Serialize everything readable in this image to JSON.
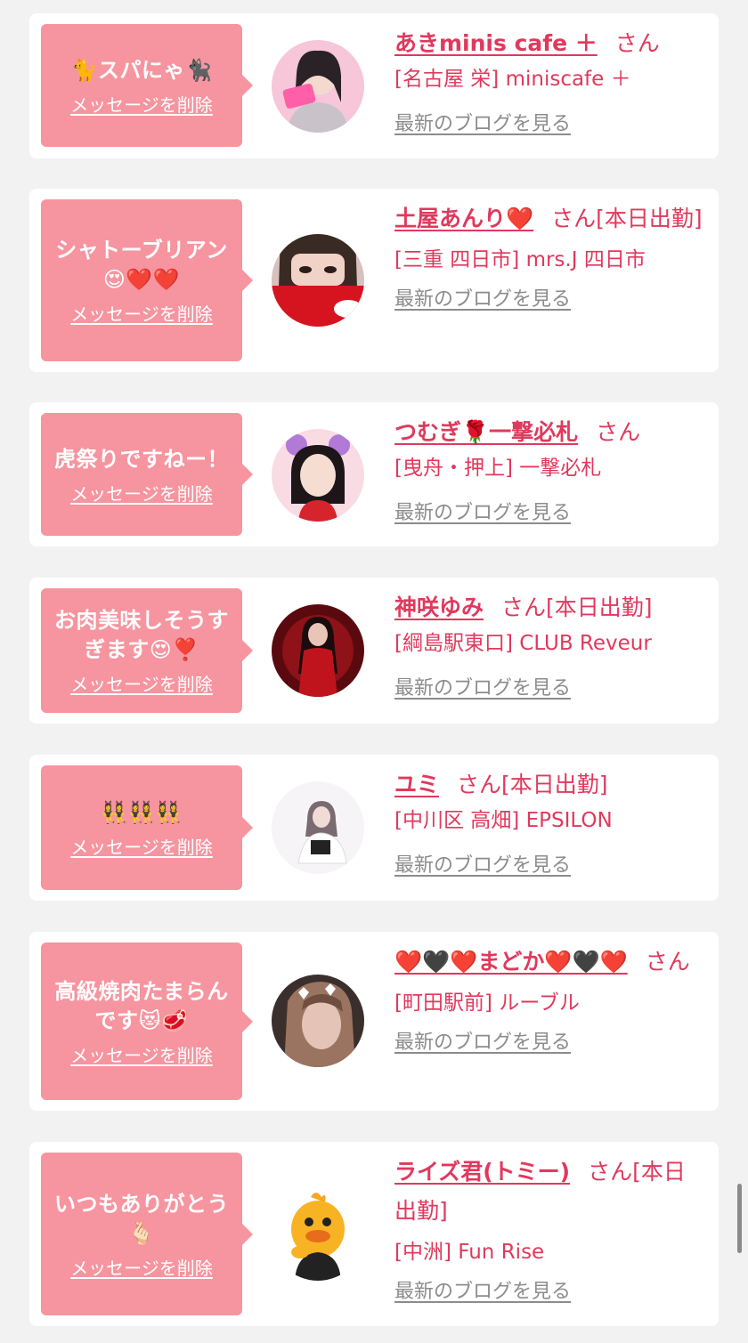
{
  "delete_label": "メッセージを削除",
  "blog_label": "最新のブログを見る",
  "san_label": "さん",
  "colors": {
    "accent": "#e0395d",
    "bubble": "#f6959f",
    "link_gray": "#8c8c8c",
    "background": "#f2f2f2"
  },
  "items": [
    {
      "message": "🐈スパにゃ🐈‍⬛",
      "name": "あきminis cafe ＋",
      "suffix": "さん",
      "shop": "[名古屋 栄] miniscafe ＋",
      "avatar_icon": "profile-photo-icon"
    },
    {
      "message": "シャトーブリアン😍❤️❤️",
      "name": "土屋あんり❤️",
      "suffix": "さん[本日出勤]",
      "shop": "[三重 四日市] mrs.J 四日市",
      "avatar_icon": "profile-photo-icon"
    },
    {
      "message": "虎祭りですねー！",
      "name": "つむぎ🌹一撃必札",
      "suffix": "さん",
      "shop": "[曳舟・押上] 一撃必札",
      "avatar_icon": "profile-photo-icon"
    },
    {
      "message": "お肉美味しそうすぎます😍❣️",
      "name": "神咲ゆみ",
      "suffix": "さん[本日出勤]",
      "shop": "[綱島駅東口] CLUB Reveur",
      "avatar_icon": "profile-photo-icon"
    },
    {
      "message": "👯‍♀️👯‍♀️👯‍♀️",
      "name": "ユミ",
      "suffix": "さん[本日出勤]",
      "shop": "[中川区 高畑] EPSILON",
      "avatar_icon": "profile-photo-icon"
    },
    {
      "message": "高級焼肉たまらんです😻🥩",
      "name": "❤️🖤❤️まどか❤️🖤❤️",
      "suffix": "さん",
      "shop": "[町田駅前] ルーブル",
      "avatar_icon": "profile-photo-icon"
    },
    {
      "message": "いつもありがとう🫰🏻",
      "name": "ライズ君(トミー)",
      "suffix": "さん[本日出勤]",
      "shop": "[中洲] Fun Rise",
      "avatar_icon": "mascot-duck-icon"
    }
  ]
}
